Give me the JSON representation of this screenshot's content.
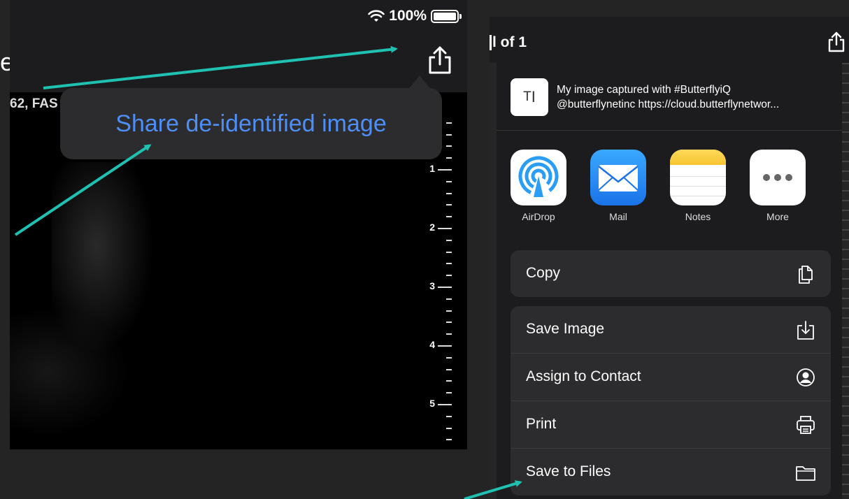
{
  "left": {
    "status_bar": {
      "battery_text": "100%",
      "battery_level": 1.0,
      "wifi_icon": "wifi-icon",
      "battery_icon": "battery-icon"
    },
    "edge_text": "e",
    "share_icon": "share-icon",
    "image_header": "62, FAS",
    "popover": {
      "label": "Share de-identified image"
    },
    "ruler": {
      "labels": [
        "1",
        "2",
        "3",
        "4",
        "5"
      ]
    }
  },
  "right": {
    "page_count": "l of 1",
    "share_icon": "share-icon",
    "preview": {
      "thumb_text": "T",
      "line1": "My image captured with #ButterflyiQ",
      "line2": "@butterflynetinc https://cloud.butterflynetwor..."
    },
    "apps": [
      {
        "label": "AirDrop",
        "icon": "airdrop-icon"
      },
      {
        "label": "Mail",
        "icon": "mail-icon"
      },
      {
        "label": "Notes",
        "icon": "notes-icon"
      },
      {
        "label": "More",
        "icon": "more-icon"
      }
    ],
    "actions_group1": [
      {
        "label": "Copy",
        "icon": "copy-icon"
      }
    ],
    "actions_group2": [
      {
        "label": "Save Image",
        "icon": "save-image-icon"
      },
      {
        "label": "Assign to Contact",
        "icon": "contact-icon"
      },
      {
        "label": "Print",
        "icon": "print-icon"
      },
      {
        "label": "Save to Files",
        "icon": "folder-icon"
      }
    ]
  },
  "colors": {
    "accent_link": "#4e8ef7",
    "annotation_arrow": "#1fc1b3",
    "panel_bg": "#1c1c1e",
    "row_bg": "#2c2c2e"
  }
}
